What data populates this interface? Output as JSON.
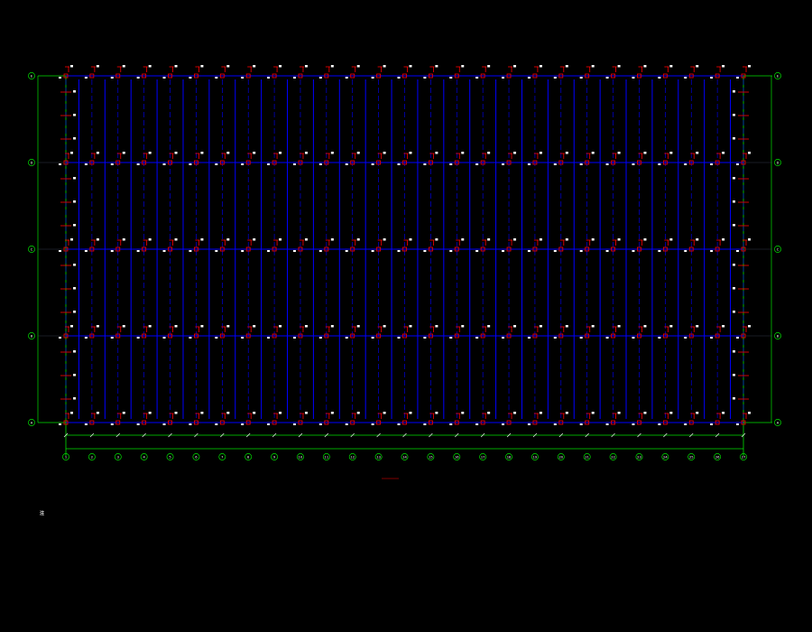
{
  "plan": {
    "title": "",
    "subtitle": "",
    "total_dimension": "",
    "column_axes": [
      "1",
      "2",
      "3",
      "4",
      "5",
      "6",
      "7",
      "8",
      "9",
      "10",
      "11",
      "12",
      "13",
      "14",
      "15",
      "16",
      "17",
      "18",
      "19",
      "20",
      "21",
      "22",
      "23",
      "24",
      "25",
      "26",
      "27"
    ],
    "row_axes": [
      "E",
      "D",
      "C",
      "B",
      "A"
    ]
  },
  "notes": {
    "header": "注",
    "lines": [
      "",
      "",
      "",
      "",
      "",
      "",
      "",
      ""
    ]
  },
  "colors": {
    "background": "#000000",
    "axis_line": "#00e000",
    "dimension_line": "#00e000",
    "beam_line": "#0000ff",
    "column_symbol": "#ff0000",
    "label_text": "#ffffff",
    "note_text": "#e8e8e8",
    "title_underline": "#ff0000"
  }
}
